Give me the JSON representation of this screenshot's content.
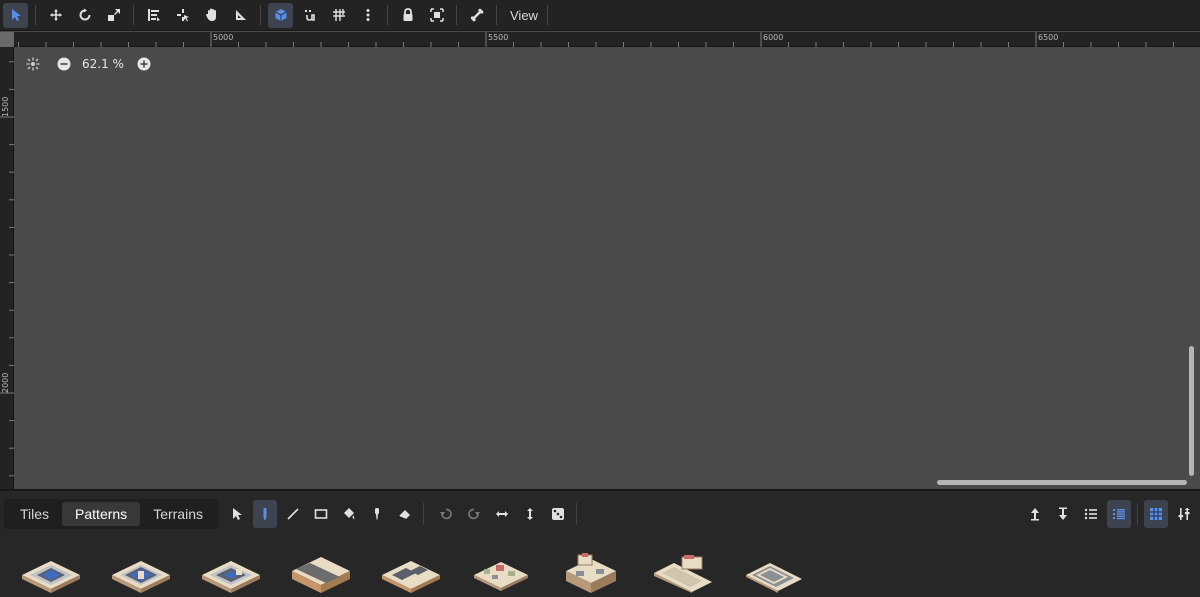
{
  "toolbar": {
    "tools": [
      {
        "name": "select-tool",
        "icon": "cursor-icon",
        "active": true
      },
      {
        "name": "move-tool",
        "icon": "move-icon"
      },
      {
        "name": "rotate-tool",
        "icon": "rotate-icon"
      },
      {
        "name": "scale-tool",
        "icon": "scale-icon"
      },
      {
        "name": "snap-list-tool",
        "icon": "list-snap-icon"
      },
      {
        "name": "pivot-tool",
        "icon": "pivot-icon"
      },
      {
        "name": "pan-tool",
        "icon": "hand-icon"
      },
      {
        "name": "ruler-tool",
        "icon": "ruler-icon"
      },
      {
        "name": "smart-snap-tool",
        "icon": "cube-icon",
        "active": true
      },
      {
        "name": "snap-tool",
        "icon": "magnet-icon"
      },
      {
        "name": "grid-tool",
        "icon": "grid-icon"
      },
      {
        "name": "more-tool",
        "icon": "kebab-icon"
      },
      {
        "name": "lock-tool",
        "icon": "lock-icon"
      },
      {
        "name": "group-tool",
        "icon": "group-icon"
      },
      {
        "name": "bone-tool",
        "icon": "bone-icon"
      }
    ],
    "view_label": "View"
  },
  "rulers": {
    "horizontal": [
      "5000",
      "5500",
      "6000",
      "6500"
    ],
    "vertical": [
      "1500",
      "2000"
    ]
  },
  "canvas": {
    "zoom_value": "62.1 %"
  },
  "bottom_panel": {
    "tabs": [
      {
        "label": "Tiles",
        "active": false
      },
      {
        "label": "Patterns",
        "active": true
      },
      {
        "label": "Terrains",
        "active": false
      }
    ],
    "accent_color": "#5a8fe8",
    "patterns": [
      "pattern-1",
      "pattern-2",
      "pattern-3",
      "pattern-4",
      "pattern-5",
      "pattern-6",
      "pattern-7",
      "pattern-8",
      "pattern-9"
    ]
  }
}
